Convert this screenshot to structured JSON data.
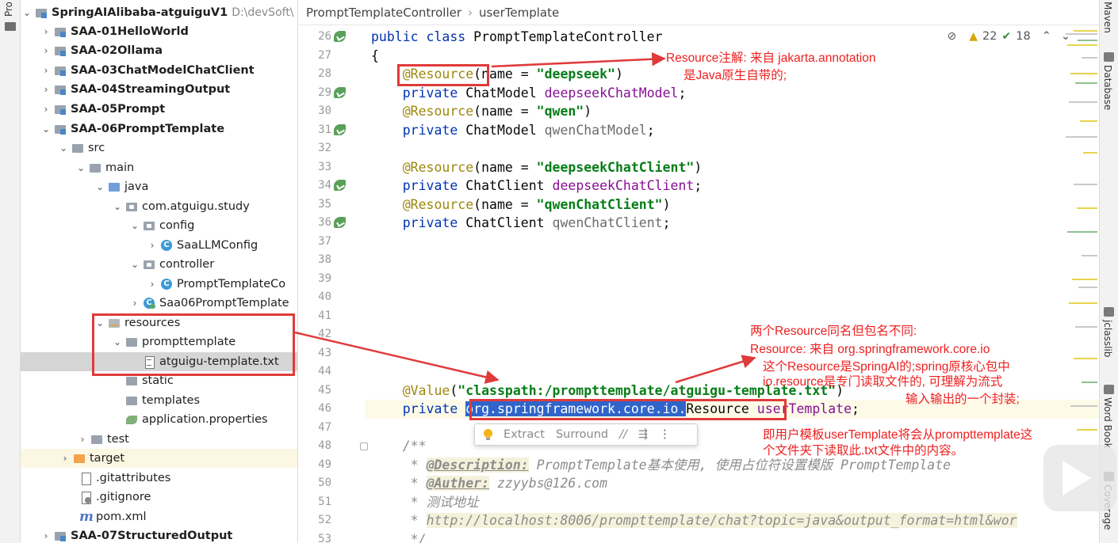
{
  "left_strip": {
    "tab_label": "Pro"
  },
  "tree": {
    "project": {
      "name": "SpringAIAlibaba-atguiguV1",
      "path": "D:\\devSoft\\"
    },
    "rows": [
      {
        "label": "SAA-01HelloWorld"
      },
      {
        "label": "SAA-02Ollama"
      },
      {
        "label": "SAA-03ChatModelChatClient"
      },
      {
        "label": "SAA-04StreamingOutput"
      },
      {
        "label": "SAA-05Prompt"
      },
      {
        "label": "SAA-06PromptTemplate"
      },
      {
        "label": "src"
      },
      {
        "label": "main"
      },
      {
        "label": "java"
      },
      {
        "label": "com.atguigu.study"
      },
      {
        "label": "config"
      },
      {
        "label": "SaaLLMConfig"
      },
      {
        "label": "controller"
      },
      {
        "label": "PromptTemplateCo"
      },
      {
        "label": "Saa06PromptTemplate"
      },
      {
        "label": "resources"
      },
      {
        "label": "prompttemplate"
      },
      {
        "label": "atguigu-template.txt"
      },
      {
        "label": "static"
      },
      {
        "label": "templates"
      },
      {
        "label": "application.properties"
      },
      {
        "label": "test"
      },
      {
        "label": "target"
      },
      {
        "label": ".gitattributes"
      },
      {
        "label": ".gitignore"
      },
      {
        "label": "pom.xml"
      },
      {
        "label": "SAA-07StructuredOutput"
      }
    ]
  },
  "breadcrumb": {
    "class_name": "PromptTemplateController",
    "sep": "›",
    "member": "userTemplate"
  },
  "inspections": {
    "warnings": "22",
    "ok": "18",
    "eye": "⊘",
    "warn_glyph": "▲",
    "ok_glyph": "✔",
    "up": "⌃",
    "down": "⌄"
  },
  "line_numbers": [
    "26",
    "27",
    "28",
    "29",
    "30",
    "31",
    "32",
    "33",
    "34",
    "35",
    "36",
    "37",
    "38",
    "39",
    "40",
    "41",
    "42",
    "43",
    "44",
    "45",
    "46",
    "47",
    "48",
    "49",
    "50",
    "51",
    "52",
    "53"
  ],
  "code": {
    "l26": {
      "kw": "public class ",
      "text": "PromptTemplateController"
    },
    "l27": {
      "text": "{"
    },
    "l28": {
      "ann": "@Resource",
      "p1": "(name = ",
      "str": "\"deepseek\"",
      "p2": ")"
    },
    "l29": {
      "kw": "private ",
      "type": "ChatModel ",
      "fld": "deepseekChatModel",
      "end": ";"
    },
    "l30": {
      "ann": "@Resource",
      "p1": "(name = ",
      "str": "\"qwen\"",
      "p2": ")"
    },
    "l31": {
      "kw": "private ",
      "type": "ChatModel ",
      "fld": "qwenChatModel",
      "end": ";"
    },
    "l33": {
      "ann": "@Resource",
      "p1": "(name = ",
      "str": "\"deepseekChatClient\"",
      "p2": ")"
    },
    "l34": {
      "kw": "private ",
      "type": "ChatClient ",
      "fld": "deepseekChatClient",
      "end": ";"
    },
    "l35": {
      "ann": "@Resource",
      "p1": "(name = ",
      "str": "\"qwenChatClient\"",
      "p2": ")"
    },
    "l36": {
      "kw": "private ",
      "type": "ChatClient ",
      "fld": "qwenChatClient",
      "end": ";"
    },
    "l45": {
      "ann": "@Value",
      "p1": "(",
      "str": "\"classpath:/prompttemplate/atguigu-template.txt\"",
      "p2": ")"
    },
    "l46": {
      "kw": "private ",
      "sel": "org.springframework.core.io.",
      "type": "Resource",
      "fld": " userTemplate",
      "end": ";"
    },
    "l48": {
      "doc": "/**"
    },
    "l49": {
      "star": " * ",
      "tag": "@Description:",
      "text": " PromptTemplate基本使用, 使用占位符设置模版 PromptTemplate"
    },
    "l50": {
      "star": " * ",
      "tag": "@Auther:",
      "text": " zzyybs@126.com"
    },
    "l51": {
      "star": " * ",
      "text": "测试地址"
    },
    "l52": {
      "star": " * ",
      "url": "http://localhost:8006/prompttemplate/chat?topic=java&output_format=html&wor"
    },
    "l53": {
      "doc": " */"
    }
  },
  "popup": {
    "extract": "Extract",
    "surround": "Surround",
    "comment_glyph": "//",
    "format_glyph": "⇶",
    "more_glyph": "⋮"
  },
  "right_strip": {
    "maven": "Maven",
    "database": "Database",
    "jclasslib": "jclasslib",
    "wordbook": "Word Book",
    "coverage": "Coverage"
  },
  "annotations": {
    "note1_line1": "Resource注解: 来自 jakarta.annotation",
    "note1_line2": "是Java原生自带的;",
    "note2_line1": "两个Resource同名但包名不同:",
    "note2_line2": "Resource: 来自 org.springframework.core.io",
    "note2_line3": "这个Resource是SpringAI的;spring原核心包中",
    "note2_line4": "io.resource是专门读取文件的, 可理解为流式",
    "note2_line5": "输入输出的一个封装;",
    "note3_line1": "即用户模板userTemplate将会从prompttemplate这",
    "note3_line2": "个文件夹下读取此.txt文件中的内容。",
    "color_red": "#e03a3a"
  }
}
